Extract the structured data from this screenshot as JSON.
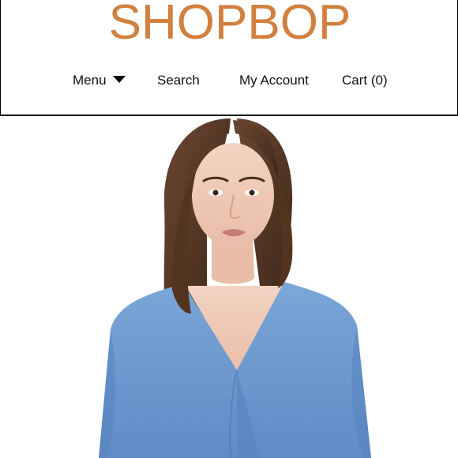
{
  "brand": {
    "logo_text": "SHOPBOP",
    "accent_color": "#d2803f"
  },
  "nav": {
    "menu_label": "Menu",
    "menu_icon": "caret-down-icon",
    "search_label": "Search",
    "account_label": "My Account",
    "cart_label": "Cart (0)"
  },
  "product_image": {
    "subject": "model-in-blue-wrap-top",
    "top_color": "#6f9bd0",
    "hair_color": "#5a3b28"
  }
}
